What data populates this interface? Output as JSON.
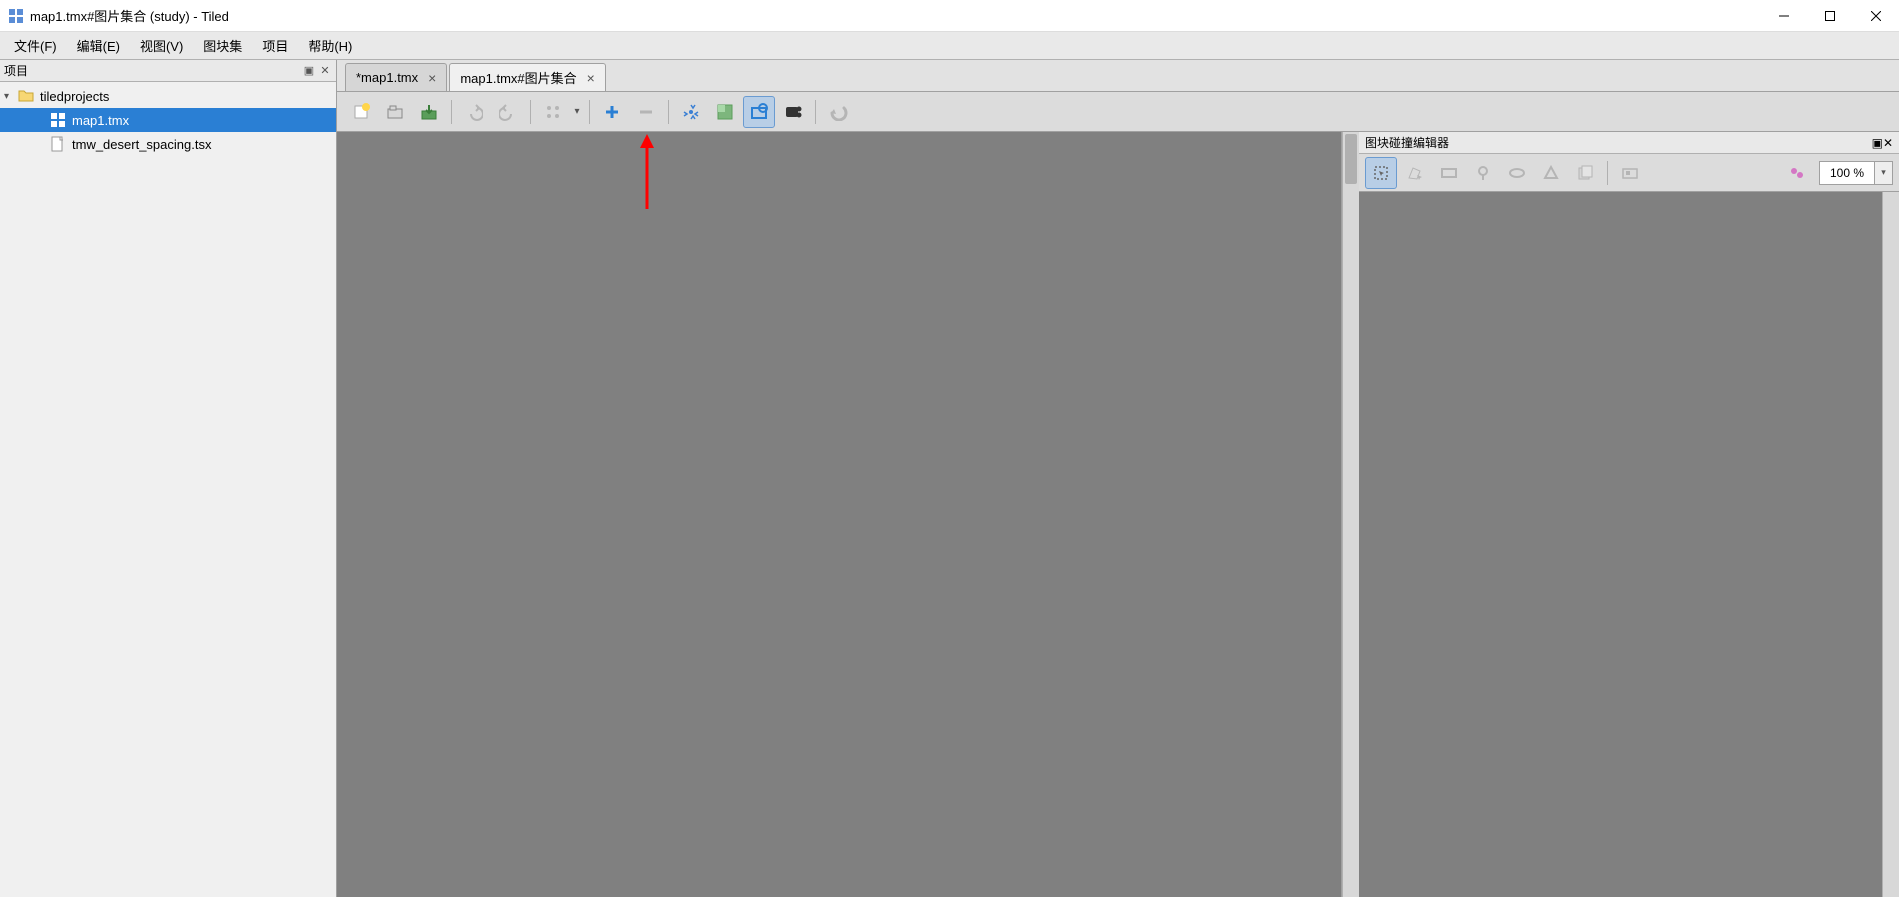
{
  "window": {
    "title": "map1.tmx#图片集合 (study) - Tiled"
  },
  "menu": {
    "file": "文件(F)",
    "edit": "编辑(E)",
    "view": "视图(V)",
    "tileset": "图块集",
    "project": "项目",
    "help": "帮助(H)"
  },
  "project_panel": {
    "title": "项目",
    "folder": "tiledprojects",
    "files": [
      "map1.tmx",
      "tmw_desert_spacing.tsx"
    ]
  },
  "tabs": [
    {
      "label": "*map1.tmx",
      "active": false
    },
    {
      "label": "map1.tmx#图片集合",
      "active": true
    }
  ],
  "collision_panel": {
    "title": "图块碰撞编辑器",
    "zoom": "100 %"
  }
}
